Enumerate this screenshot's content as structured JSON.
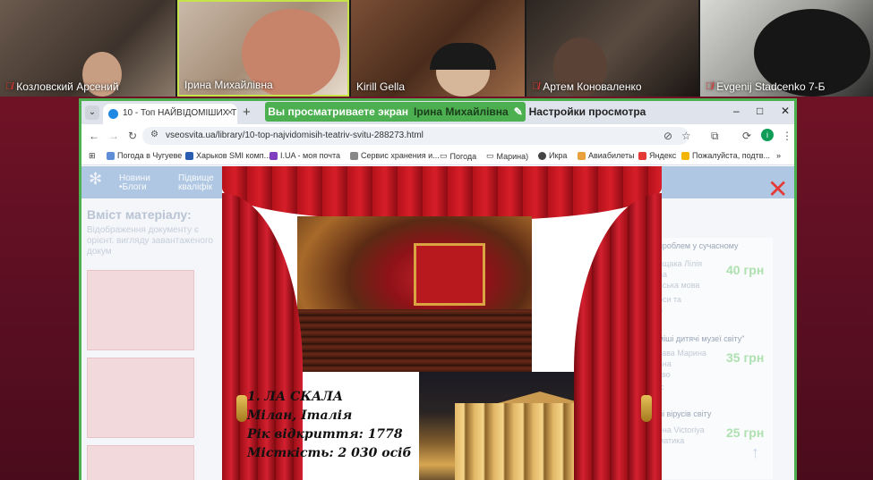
{
  "participants": [
    {
      "name": "Козловский Арсений",
      "muted": true
    },
    {
      "name": "Ірина Михайлівна",
      "muted": false
    },
    {
      "name": "Kirill Gella",
      "muted": false
    },
    {
      "name": "Артем Коноваленко",
      "muted": true
    },
    {
      "name": "Evgenij Stadcenko 7-Б",
      "muted": true
    }
  ],
  "share": {
    "banner_prefix": "Вы просматриваете экран",
    "presenter": "Ірина Михайлівна",
    "settings_label": "Настройки просмотра",
    "accent": "#4caf50"
  },
  "browser": {
    "tab_title": "10 - Топ НАЙВІДОМІШИХ ТЕ",
    "url": "vseosvita.ua/library/10-top-najvidomisih-teatriv-svitu-288273.html",
    "profile_letter": "i",
    "bookmarks": [
      "Погода в Чугуеве",
      "Харьков SMI комп...",
      "I.UA - моя почта",
      "Сервис хранения и...",
      "Погода",
      "Марина)",
      "Икра",
      "Авиабилеты",
      "Яндекс",
      "Пожалуйста, подтв..."
    ]
  },
  "site": {
    "nav1_line1": "Новини",
    "nav1_line2": "•Блоги",
    "nav2_line1": "Підвище",
    "nav2_line2": "кваліфік",
    "content_title": "Вміст матеріалу:",
    "content_sub": "Відображення документу є орієнт. вигляду завантаженого докум",
    "cards": [
      {
        "title": "проблем у сучасному",
        "line1": "ищака Лілія",
        "line2": "на",
        "line3": "ьська мова",
        "line4": "рси та",
        "line5": "и",
        "price": "40 грн"
      },
      {
        "title": "міші дитячі музеї світу\"",
        "line1": "зава Марина",
        "line2": "вна",
        "line3": "тво",
        "line4": "іс",
        "price": "35 грн"
      },
      {
        "title": "ні вірусів світу",
        "line1": "яна Victoriya",
        "line2": "матика",
        "price": "25 грн"
      }
    ]
  },
  "slide": {
    "line1": "1. ЛА СКАЛА",
    "line2": "Мілан, Італія",
    "line3": "Рік відкриття: 1778",
    "line4": "Місткість: 2 030 осіб"
  },
  "icons": {
    "mic_off": "mic-off-icon",
    "close_overlay": "close-icon"
  }
}
